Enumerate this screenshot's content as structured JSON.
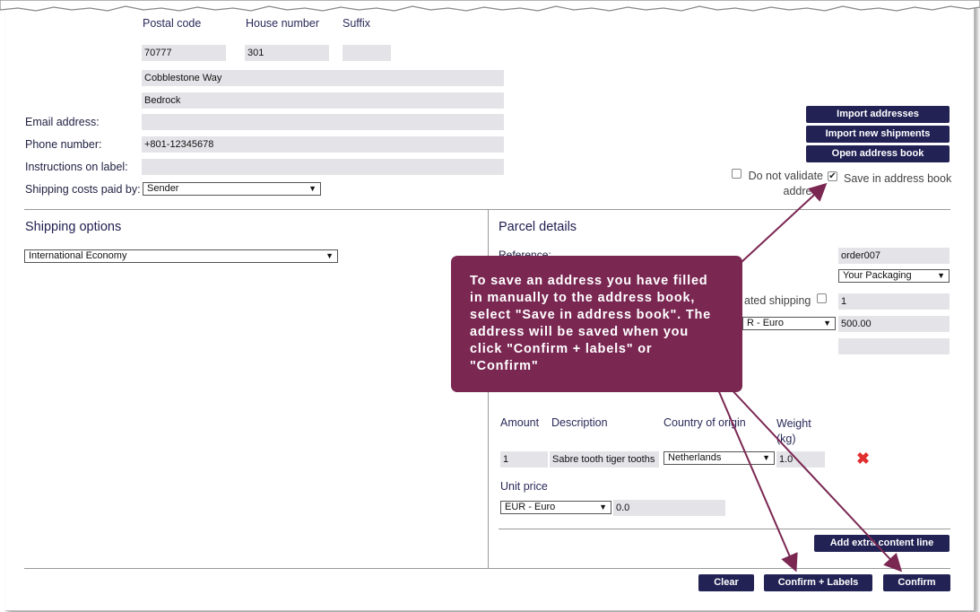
{
  "address_form": {
    "postal_code_label": "Postal code",
    "house_number_label": "House number",
    "suffix_label": "Suffix",
    "postal_code_value": "70777",
    "house_number_value": "301",
    "suffix_value": "",
    "street_value": "Cobblestone Way",
    "city_value": "Bedrock",
    "email_label": "Email address:",
    "email_value": "",
    "phone_label": "Phone number:",
    "phone_value": "+801-12345678",
    "instructions_label": "Instructions on label:",
    "instructions_value": "",
    "shipping_costs_label": "Shipping costs paid by:",
    "shipping_costs_value": "Sender"
  },
  "side_buttons": {
    "import_addresses": "Import addresses",
    "import_shipments": "Import new shipments",
    "open_address_book": "Open address book"
  },
  "options": {
    "do_not_validate_line1": "Do not validate",
    "do_not_validate_line2": "address",
    "do_not_validate_checked": false,
    "save_in_address_book": "Save in address book",
    "save_in_address_book_checked": true
  },
  "shipping_options": {
    "title": "Shipping options",
    "method_value": "International Economy"
  },
  "parcel_details": {
    "title": "Parcel details",
    "reference_label": "Reference:",
    "reference_value": "order007",
    "packaging_value": "Your Packaging",
    "insured_label_partial": "ated shipping",
    "quantity_value": "1",
    "currency_partial": "R - Euro",
    "value_amount": "500.00",
    "extra_value": ""
  },
  "content_table": {
    "headers": {
      "amount": "Amount",
      "description": "Description",
      "country": "Country of origin",
      "weight_line1": "Weight",
      "weight_line2": "(kg)"
    },
    "row": {
      "amount": "1",
      "description": "Sabre tooth tiger tooths",
      "country": "Netherlands",
      "weight": "1.0"
    },
    "unit_price_label": "Unit price",
    "unit_price_currency": "EUR - Euro",
    "unit_price_value": "0.0"
  },
  "actions": {
    "add_extra_line": "Add extra content line",
    "clear": "Clear",
    "confirm_labels": "Confirm + Labels",
    "confirm": "Confirm"
  },
  "tooltip": {
    "text": "To save an address you have filled in manually to the address book, select \"Save in address book\". The address will be saved when you click \"Confirm + labels\" or \"Confirm\""
  },
  "colors": {
    "button_bg": "#222255",
    "tooltip_bg": "#7a2752",
    "arrow": "#7a2752",
    "field_bg": "#e4e4e8",
    "delete_icon": "#e03030"
  },
  "icons": {
    "delete": "red-x-icon",
    "dropdown": "chevron-down-icon",
    "checkbox": "checkmark-icon"
  }
}
